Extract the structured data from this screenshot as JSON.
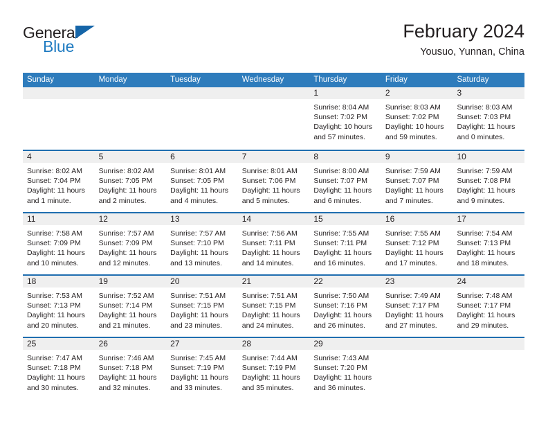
{
  "brand": {
    "name_part1": "General",
    "name_part2": "Blue"
  },
  "header": {
    "title": "February 2024",
    "subtitle": "Yousuo, Yunnan, China"
  },
  "colors": {
    "header_blue": "#2e7cbc",
    "rule_blue": "#1f6eb0",
    "daynum_band": "#efefef",
    "brand_blue": "#1f7bc1",
    "text": "#231f20"
  },
  "weekday_headers": [
    "Sunday",
    "Monday",
    "Tuesday",
    "Wednesday",
    "Thursday",
    "Friday",
    "Saturday"
  ],
  "weeks": [
    [
      {
        "day": "",
        "empty": true,
        "lines": []
      },
      {
        "day": "",
        "empty": true,
        "lines": []
      },
      {
        "day": "",
        "empty": true,
        "lines": []
      },
      {
        "day": "",
        "empty": true,
        "lines": []
      },
      {
        "day": "1",
        "empty": false,
        "lines": [
          "Sunrise: 8:04 AM",
          "Sunset: 7:02 PM",
          "Daylight: 10 hours",
          "and 57 minutes."
        ]
      },
      {
        "day": "2",
        "empty": false,
        "lines": [
          "Sunrise: 8:03 AM",
          "Sunset: 7:02 PM",
          "Daylight: 10 hours",
          "and 59 minutes."
        ]
      },
      {
        "day": "3",
        "empty": false,
        "lines": [
          "Sunrise: 8:03 AM",
          "Sunset: 7:03 PM",
          "Daylight: 11 hours",
          "and 0 minutes."
        ]
      }
    ],
    [
      {
        "day": "4",
        "empty": false,
        "lines": [
          "Sunrise: 8:02 AM",
          "Sunset: 7:04 PM",
          "Daylight: 11 hours",
          "and 1 minute."
        ]
      },
      {
        "day": "5",
        "empty": false,
        "lines": [
          "Sunrise: 8:02 AM",
          "Sunset: 7:05 PM",
          "Daylight: 11 hours",
          "and 2 minutes."
        ]
      },
      {
        "day": "6",
        "empty": false,
        "lines": [
          "Sunrise: 8:01 AM",
          "Sunset: 7:05 PM",
          "Daylight: 11 hours",
          "and 4 minutes."
        ]
      },
      {
        "day": "7",
        "empty": false,
        "lines": [
          "Sunrise: 8:01 AM",
          "Sunset: 7:06 PM",
          "Daylight: 11 hours",
          "and 5 minutes."
        ]
      },
      {
        "day": "8",
        "empty": false,
        "lines": [
          "Sunrise: 8:00 AM",
          "Sunset: 7:07 PM",
          "Daylight: 11 hours",
          "and 6 minutes."
        ]
      },
      {
        "day": "9",
        "empty": false,
        "lines": [
          "Sunrise: 7:59 AM",
          "Sunset: 7:07 PM",
          "Daylight: 11 hours",
          "and 7 minutes."
        ]
      },
      {
        "day": "10",
        "empty": false,
        "lines": [
          "Sunrise: 7:59 AM",
          "Sunset: 7:08 PM",
          "Daylight: 11 hours",
          "and 9 minutes."
        ]
      }
    ],
    [
      {
        "day": "11",
        "empty": false,
        "lines": [
          "Sunrise: 7:58 AM",
          "Sunset: 7:09 PM",
          "Daylight: 11 hours",
          "and 10 minutes."
        ]
      },
      {
        "day": "12",
        "empty": false,
        "lines": [
          "Sunrise: 7:57 AM",
          "Sunset: 7:09 PM",
          "Daylight: 11 hours",
          "and 12 minutes."
        ]
      },
      {
        "day": "13",
        "empty": false,
        "lines": [
          "Sunrise: 7:57 AM",
          "Sunset: 7:10 PM",
          "Daylight: 11 hours",
          "and 13 minutes."
        ]
      },
      {
        "day": "14",
        "empty": false,
        "lines": [
          "Sunrise: 7:56 AM",
          "Sunset: 7:11 PM",
          "Daylight: 11 hours",
          "and 14 minutes."
        ]
      },
      {
        "day": "15",
        "empty": false,
        "lines": [
          "Sunrise: 7:55 AM",
          "Sunset: 7:11 PM",
          "Daylight: 11 hours",
          "and 16 minutes."
        ]
      },
      {
        "day": "16",
        "empty": false,
        "lines": [
          "Sunrise: 7:55 AM",
          "Sunset: 7:12 PM",
          "Daylight: 11 hours",
          "and 17 minutes."
        ]
      },
      {
        "day": "17",
        "empty": false,
        "lines": [
          "Sunrise: 7:54 AM",
          "Sunset: 7:13 PM",
          "Daylight: 11 hours",
          "and 18 minutes."
        ]
      }
    ],
    [
      {
        "day": "18",
        "empty": false,
        "lines": [
          "Sunrise: 7:53 AM",
          "Sunset: 7:13 PM",
          "Daylight: 11 hours",
          "and 20 minutes."
        ]
      },
      {
        "day": "19",
        "empty": false,
        "lines": [
          "Sunrise: 7:52 AM",
          "Sunset: 7:14 PM",
          "Daylight: 11 hours",
          "and 21 minutes."
        ]
      },
      {
        "day": "20",
        "empty": false,
        "lines": [
          "Sunrise: 7:51 AM",
          "Sunset: 7:15 PM",
          "Daylight: 11 hours",
          "and 23 minutes."
        ]
      },
      {
        "day": "21",
        "empty": false,
        "lines": [
          "Sunrise: 7:51 AM",
          "Sunset: 7:15 PM",
          "Daylight: 11 hours",
          "and 24 minutes."
        ]
      },
      {
        "day": "22",
        "empty": false,
        "lines": [
          "Sunrise: 7:50 AM",
          "Sunset: 7:16 PM",
          "Daylight: 11 hours",
          "and 26 minutes."
        ]
      },
      {
        "day": "23",
        "empty": false,
        "lines": [
          "Sunrise: 7:49 AM",
          "Sunset: 7:17 PM",
          "Daylight: 11 hours",
          "and 27 minutes."
        ]
      },
      {
        "day": "24",
        "empty": false,
        "lines": [
          "Sunrise: 7:48 AM",
          "Sunset: 7:17 PM",
          "Daylight: 11 hours",
          "and 29 minutes."
        ]
      }
    ],
    [
      {
        "day": "25",
        "empty": false,
        "lines": [
          "Sunrise: 7:47 AM",
          "Sunset: 7:18 PM",
          "Daylight: 11 hours",
          "and 30 minutes."
        ]
      },
      {
        "day": "26",
        "empty": false,
        "lines": [
          "Sunrise: 7:46 AM",
          "Sunset: 7:18 PM",
          "Daylight: 11 hours",
          "and 32 minutes."
        ]
      },
      {
        "day": "27",
        "empty": false,
        "lines": [
          "Sunrise: 7:45 AM",
          "Sunset: 7:19 PM",
          "Daylight: 11 hours",
          "and 33 minutes."
        ]
      },
      {
        "day": "28",
        "empty": false,
        "lines": [
          "Sunrise: 7:44 AM",
          "Sunset: 7:19 PM",
          "Daylight: 11 hours",
          "and 35 minutes."
        ]
      },
      {
        "day": "29",
        "empty": false,
        "lines": [
          "Sunrise: 7:43 AM",
          "Sunset: 7:20 PM",
          "Daylight: 11 hours",
          "and 36 minutes."
        ]
      },
      {
        "day": "",
        "empty": true,
        "lines": []
      },
      {
        "day": "",
        "empty": true,
        "lines": []
      }
    ]
  ]
}
